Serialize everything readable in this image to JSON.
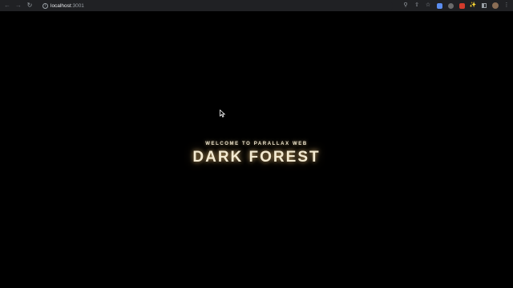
{
  "browser": {
    "url_host": "localhost",
    "url_port": ":3001",
    "icons": {
      "back": "back-arrow-icon",
      "forward": "forward-arrow-icon",
      "reload": "reload-icon",
      "site_info": "info-icon",
      "search": "search-icon",
      "share": "share-icon",
      "bookmark": "star-icon",
      "extensions": "puzzle-icon",
      "side_panel": "side-panel-icon",
      "menu": "kebab-menu-icon"
    }
  },
  "hero": {
    "subtitle": "WELCOME TO PARALLAX WEB",
    "title": "DARK FOREST"
  },
  "colors": {
    "background": "#000000",
    "title_text": "#f3ead2",
    "title_glow": "#ffd28a",
    "chrome_bar": "#202124"
  }
}
